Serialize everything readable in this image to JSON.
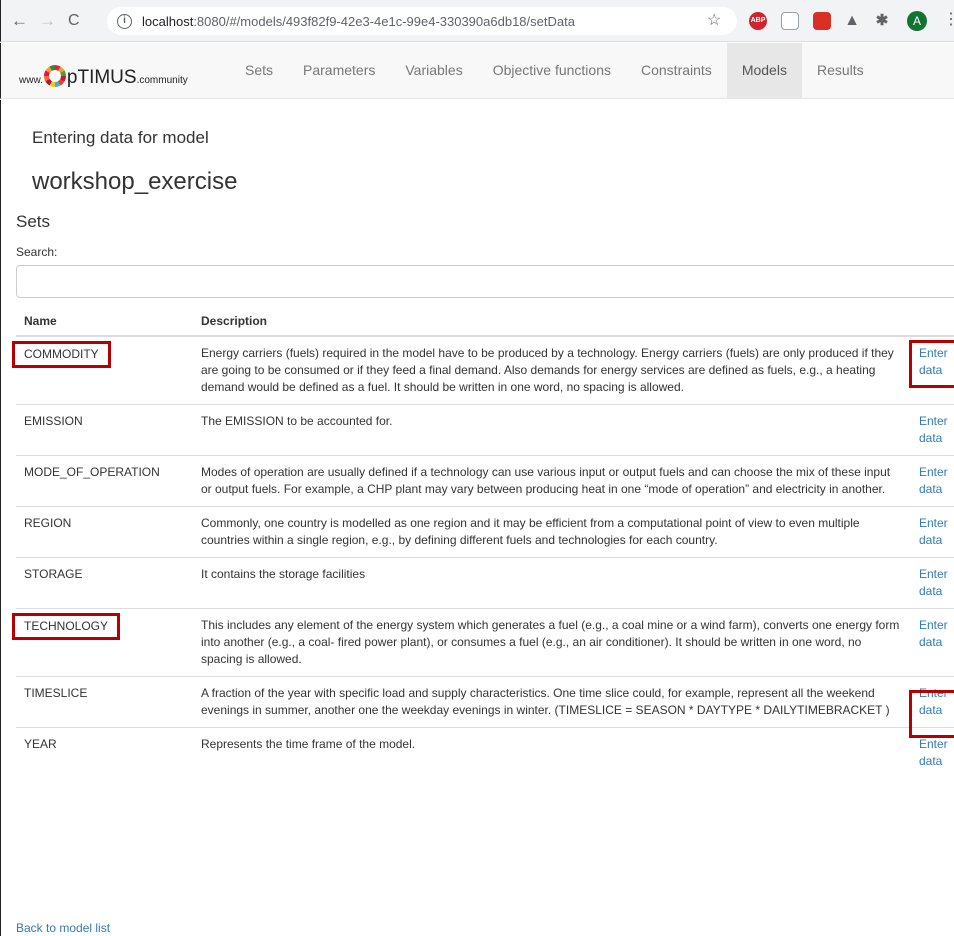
{
  "browser": {
    "url_host": "localhost",
    "url_rest": ":8080/#/models/493f82f9-42e3-4e1c-99e4-330390a6db18/setData",
    "nav_back": "←",
    "nav_forward": "→",
    "nav_reload": "C",
    "info_glyph": "i",
    "star_glyph": "☆",
    "ext_abp_label": "ABP",
    "avatar_letter": "A",
    "kebab_glyph": "⋮"
  },
  "navbar": {
    "brand_prefix": "www.",
    "brand_main": "pTIMUS",
    "brand_suffix": ".community",
    "links": [
      "Sets",
      "Parameters",
      "Variables",
      "Objective functions",
      "Constraints",
      "Models",
      "Results"
    ],
    "active": "Models"
  },
  "page": {
    "subtitle": "Entering data for model",
    "model_name": "workshop_exercise",
    "sets_heading": "Sets",
    "search_label": "Search:",
    "search_value": "",
    "back_link": "Back to model list"
  },
  "table": {
    "headers": {
      "name": "Name",
      "description": "Description",
      "action": ""
    },
    "action_label": "Enter data",
    "rows": [
      {
        "name": "COMMODITY",
        "description": "Energy carriers (fuels) required in the model have to be produced by a technology. Energy carriers (fuels) are only produced if they are going to be consumed or if they feed a final demand. Also demands for energy services are defined as fuels, e.g., a heating demand would be defined as a fuel. It should be written in one word, no spacing is allowed."
      },
      {
        "name": "EMISSION",
        "description": "The EMISSION to be accounted for."
      },
      {
        "name": "MODE_OF_OPERATION",
        "description": "Modes of operation are usually defined if a technology can use various input or output fuels and can choose the mix of these input or output fuels. For example, a CHP plant may vary between producing heat in one “mode of operation” and electricity in another."
      },
      {
        "name": "REGION",
        "description": "Commonly, one country is modelled as one region and it may be efficient from a computational point of view to even multiple countries within a single region, e.g., by defining different fuels and technologies for each country."
      },
      {
        "name": "STORAGE",
        "description": "It contains the storage facilities"
      },
      {
        "name": "TECHNOLOGY",
        "description": "This includes any element of the energy system which generates a fuel (e.g., a coal mine or a wind farm), converts one energy form into another (e.g., a coal- fired power plant), or consumes a fuel (e.g., an air conditioner). It should be written in one word, no spacing is allowed."
      },
      {
        "name": "TIMESLICE",
        "description": "A fraction of the year with specific load and supply characteristics. One time slice could, for example, represent all the weekend evenings in summer, another one the weekday evenings in winter. (TIMESLICE = SEASON * DAYTYPE * DAILYTIMEBRACKET )"
      },
      {
        "name": "YEAR",
        "description": "Represents the time frame of the model."
      }
    ]
  },
  "colors": {
    "highlight": "#b40000",
    "link": "#337ab7",
    "navbar_bg": "#f8f8f8"
  }
}
